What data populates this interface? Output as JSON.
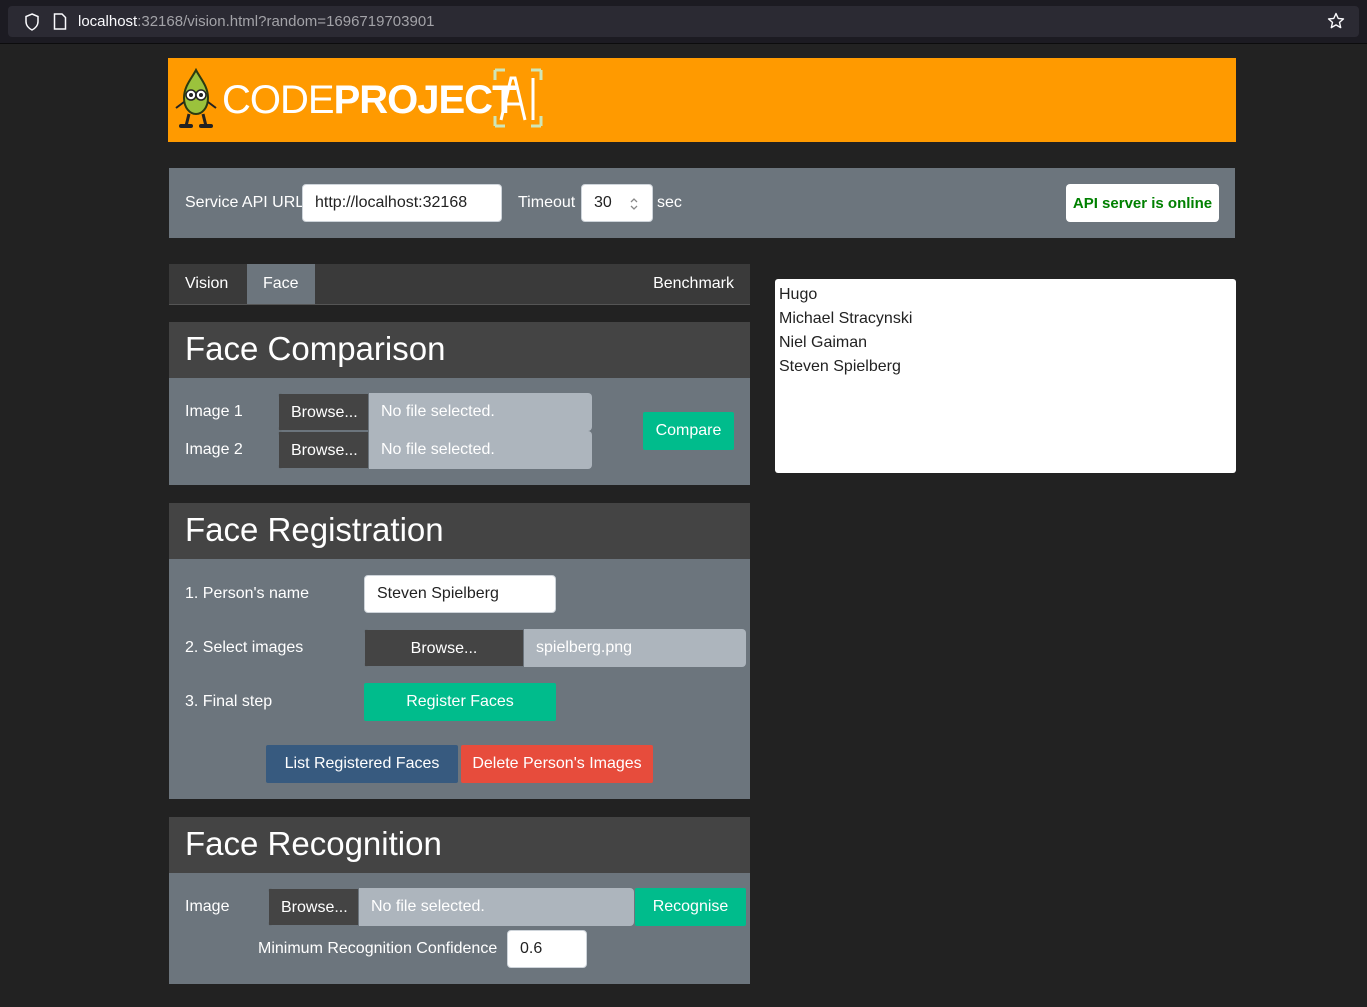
{
  "browser": {
    "url_host": "localhost",
    "url_rest": ":32168/vision.html?random=1696719703901"
  },
  "banner": {
    "logo_light": "CODE",
    "logo_bold": "PROJECT",
    "logo_ai": "AI",
    "brand_color": "#ff9a00"
  },
  "settings": {
    "api_url_label": "Service API URL",
    "api_url_value": "http://localhost:32168",
    "timeout_label": "Timeout",
    "timeout_value": "30",
    "timeout_unit": "sec",
    "status_text": "API server is online",
    "status_color": "#008000"
  },
  "tabs": [
    {
      "label": "Vision",
      "active": false
    },
    {
      "label": "Face",
      "active": true
    },
    {
      "label": "Benchmark",
      "active": false
    }
  ],
  "face_comparison": {
    "title": "Face Comparison",
    "image1_label": "Image 1",
    "image2_label": "Image 2",
    "browse_label": "Browse...",
    "no_file": "No file selected.",
    "compare_label": "Compare"
  },
  "face_registration": {
    "title": "Face Registration",
    "step1_label": "1. Person's name",
    "person_name": "Steven Spielberg",
    "step2_label": "2. Select images",
    "browse_label": "Browse...",
    "selected_file": "spielberg.png",
    "step3_label": "3. Final step",
    "register_label": "Register Faces",
    "list_label": "List Registered Faces",
    "delete_label": "Delete Person's Images"
  },
  "face_recognition": {
    "title": "Face Recognition",
    "image_label": "Image",
    "browse_label": "Browse...",
    "no_file": "No file selected.",
    "recognise_label": "Recognise",
    "confidence_label": "Minimum Recognition Confidence",
    "confidence_value": "0.6"
  },
  "registered_faces": [
    "Hugo",
    "Michael Stracynski",
    "Niel Gaiman",
    "Steven Spielberg"
  ],
  "colors": {
    "green": "#00bc8c",
    "blue": "#375a7f",
    "red": "#e74c3c",
    "panel": "#6c757d",
    "header": "#444444"
  }
}
